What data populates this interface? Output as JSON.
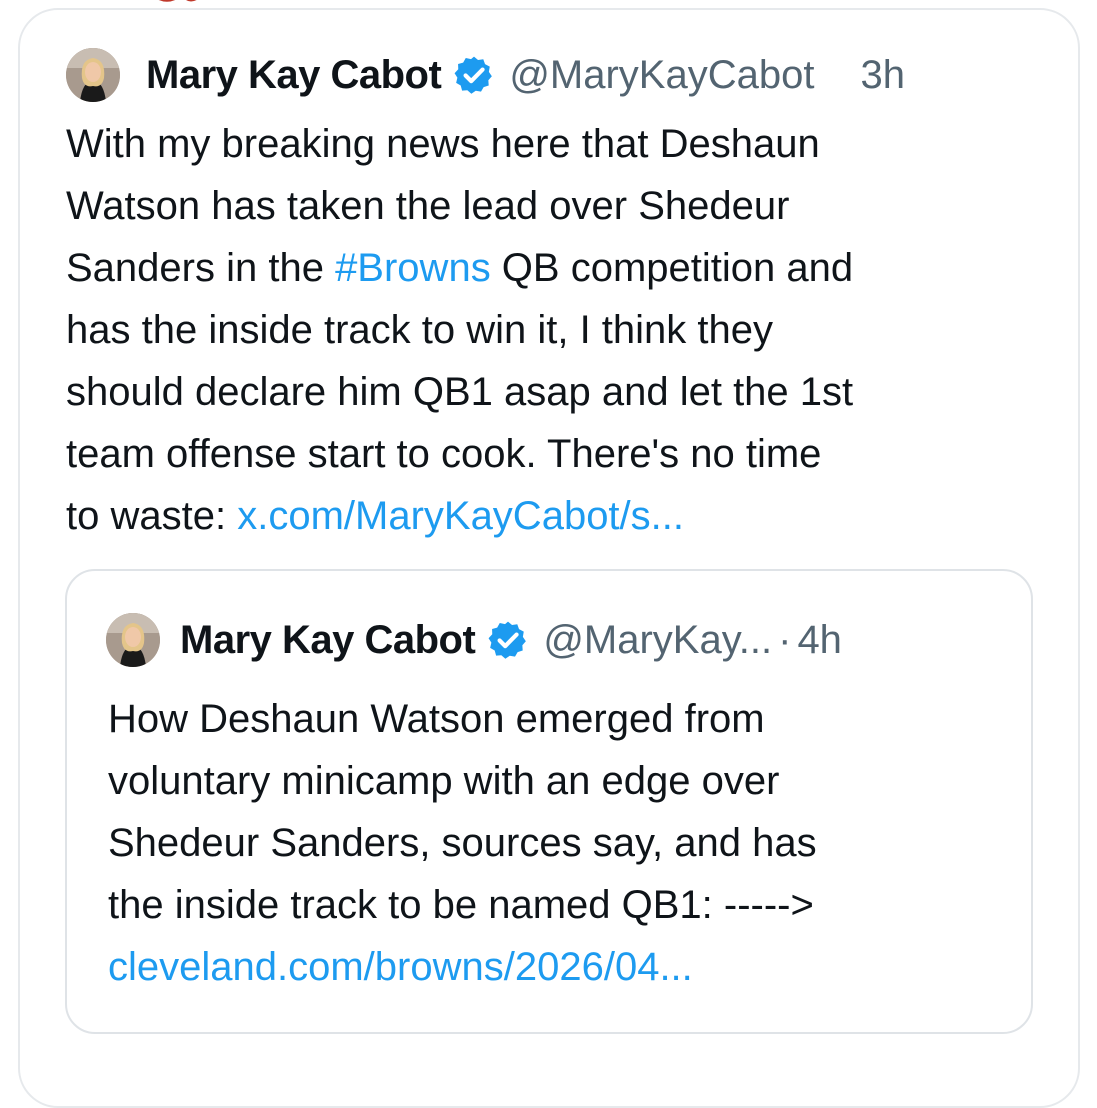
{
  "tweet": {
    "author_name": "Mary Kay Cabot",
    "handle": "@MaryKayCabot",
    "time": "3h",
    "text_parts": {
      "before_hashtag": "With my breaking news here that Deshaun\nWatson has taken the lead over Shedeur\nSanders in the ",
      "hashtag": "#Browns",
      "after_hashtag": " QB competition and\nhas the inside track to win it, I think they\nshould declare him QB1 asap and let the 1st\nteam offense start to cook. There's no time\nto waste: ",
      "link": "x.com/MaryKayCabot/s..."
    }
  },
  "quoted_tweet": {
    "author_name": "Mary Kay Cabot",
    "handle": "@MaryKay...",
    "separator": "·",
    "time": "4h",
    "text": "How Deshaun Watson emerged from\nvoluntary minicamp with an edge over\nShedeur Sanders, sources say, and has\nthe inside track to be named QB1: ----->\n",
    "link": "cleveland.com/browns/2026/04..."
  },
  "icons": {
    "verified": "verified-badge-icon",
    "avatar": "profile-avatar"
  },
  "colors": {
    "text": "#0f1419",
    "secondary": "#536471",
    "link": "#1d9bf0",
    "border": "#e6e9ec"
  }
}
